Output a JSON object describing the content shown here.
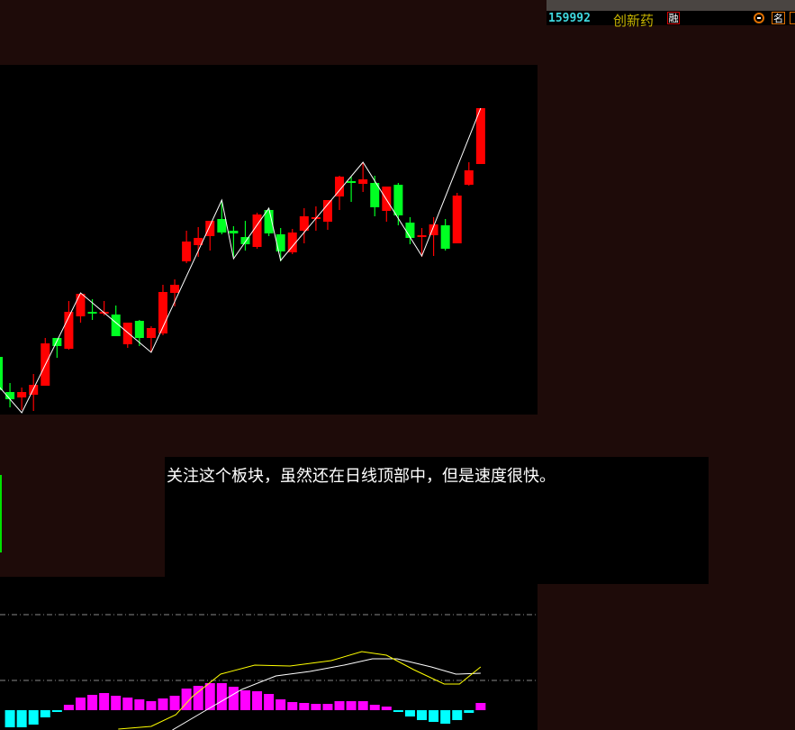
{
  "header": {
    "code": "159992",
    "name": "创新药",
    "rong_badge": "融",
    "ming_button": "名",
    "icons": [
      "minus-circle-icon"
    ]
  },
  "note": {
    "text": "关注这个板块，虽然还在日线顶部中，但是速度很快。"
  },
  "colors": {
    "up": "#ff0000",
    "down": "#00ff22",
    "zigzag": "#ffffff",
    "dif": "#ffff00",
    "dea": "#ffffff",
    "macd_pos": "#ff00ff",
    "macd_neg": "#00ffff",
    "background": "#1e0b09"
  },
  "chart_data": [
    {
      "type": "candlestick",
      "title": "",
      "columns": [
        "open",
        "close",
        "high",
        "low"
      ],
      "candles": [
        [
          1.04,
          0.67,
          1.04,
          0.6
        ],
        [
          0.65,
          0.57,
          0.75,
          0.48
        ],
        [
          0.59,
          0.65,
          0.7,
          0.45
        ],
        [
          0.62,
          0.73,
          0.85,
          0.44
        ],
        [
          0.72,
          1.19,
          1.25,
          0.72
        ],
        [
          1.25,
          1.16,
          1.25,
          1.03
        ],
        [
          1.13,
          1.54,
          1.66,
          1.12
        ],
        [
          1.49,
          1.74,
          1.74,
          1.42
        ],
        [
          1.54,
          1.53,
          1.68,
          1.45
        ],
        [
          1.53,
          1.54,
          1.66,
          1.5
        ],
        [
          1.51,
          1.27,
          1.61,
          1.27
        ],
        [
          1.18,
          1.42,
          1.42,
          1.14
        ],
        [
          1.44,
          1.25,
          1.45,
          1.16
        ],
        [
          1.25,
          1.36,
          1.38,
          1.09
        ],
        [
          1.3,
          1.76,
          1.84,
          1.28
        ],
        [
          1.75,
          1.84,
          1.9,
          1.6
        ],
        [
          2.1,
          2.32,
          2.44,
          2.08
        ],
        [
          2.28,
          2.36,
          2.48,
          2.15
        ],
        [
          2.38,
          2.55,
          2.55,
          2.22
        ],
        [
          2.57,
          2.42,
          2.78,
          2.4
        ],
        [
          2.44,
          2.41,
          2.49,
          2.15
        ],
        [
          2.37,
          2.29,
          2.55,
          2.22
        ],
        [
          2.26,
          2.62,
          2.64,
          2.24
        ],
        [
          2.67,
          2.41,
          2.69,
          2.38
        ],
        [
          2.4,
          2.21,
          2.47,
          2.1
        ],
        [
          2.2,
          2.42,
          2.46,
          2.18
        ],
        [
          2.44,
          2.6,
          2.69,
          2.3
        ],
        [
          2.57,
          2.59,
          2.71,
          2.44
        ],
        [
          2.54,
          2.78,
          2.78,
          2.45
        ],
        [
          2.82,
          3.04,
          3.05,
          2.67
        ],
        [
          2.99,
          2.97,
          3.04,
          2.76
        ],
        [
          2.96,
          3.01,
          3.2,
          2.87
        ],
        [
          2.97,
          2.7,
          3.05,
          2.6
        ],
        [
          2.66,
          2.93,
          2.93,
          2.54
        ],
        [
          2.95,
          2.61,
          2.97,
          2.5
        ],
        [
          2.53,
          2.36,
          2.59,
          2.29
        ],
        [
          2.37,
          2.39,
          2.47,
          2.15
        ],
        [
          2.39,
          2.51,
          2.59,
          2.16
        ],
        [
          2.5,
          2.24,
          2.57,
          2.22
        ],
        [
          2.3,
          2.83,
          2.86,
          2.3
        ],
        [
          2.95,
          3.11,
          3.2,
          2.94
        ],
        [
          3.18,
          3.8,
          3.8,
          3.18
        ]
      ],
      "zigzag": [
        [
          0,
          0.72
        ],
        [
          2,
          0.42
        ],
        [
          7,
          1.75
        ],
        [
          13,
          1.09
        ],
        [
          19,
          2.78
        ],
        [
          20,
          2.13
        ],
        [
          23,
          2.69
        ],
        [
          24,
          2.11
        ],
        [
          31,
          3.2
        ],
        [
          36,
          2.16
        ],
        [
          41,
          3.8
        ]
      ],
      "yrange": [
        0.1,
        3.9
      ]
    },
    {
      "type": "bar",
      "title": "MACD",
      "start_index": 1,
      "macd": [
        -0.19,
        -0.19,
        -0.16,
        -0.08,
        -0.02,
        0.06,
        0.14,
        0.17,
        0.19,
        0.16,
        0.14,
        0.12,
        0.1,
        0.13,
        0.16,
        0.24,
        0.27,
        0.3,
        0.3,
        0.26,
        0.22,
        0.21,
        0.18,
        0.12,
        0.09,
        0.08,
        0.07,
        0.07,
        0.1,
        0.1,
        0.1,
        0.06,
        0.04,
        -0.01,
        -0.07,
        -0.11,
        -0.13,
        -0.15,
        -0.11,
        -0.03,
        0.08
      ],
      "dif": [
        [
          10.2,
          -0.21
        ],
        [
          13,
          -0.18
        ],
        [
          15.1,
          -0.05
        ],
        [
          16.5,
          0.15
        ],
        [
          18.9,
          0.4
        ],
        [
          21.8,
          0.5
        ],
        [
          24.8,
          0.49
        ],
        [
          28.3,
          0.55
        ],
        [
          30.9,
          0.65
        ],
        [
          33,
          0.61
        ],
        [
          35.3,
          0.45
        ],
        [
          37.9,
          0.29
        ],
        [
          39.2,
          0.29
        ],
        [
          41,
          0.48
        ]
      ],
      "dea": [
        [
          14.8,
          -0.22
        ],
        [
          17.8,
          0.01
        ],
        [
          20.7,
          0.23
        ],
        [
          23.6,
          0.38
        ],
        [
          26.5,
          0.43
        ],
        [
          29.4,
          0.5
        ],
        [
          31.8,
          0.57
        ],
        [
          33.9,
          0.57
        ],
        [
          36.8,
          0.48
        ],
        [
          38.9,
          0.4
        ],
        [
          41,
          0.41
        ]
      ],
      "reference_levels": [
        1.06,
        0.33
      ]
    }
  ]
}
